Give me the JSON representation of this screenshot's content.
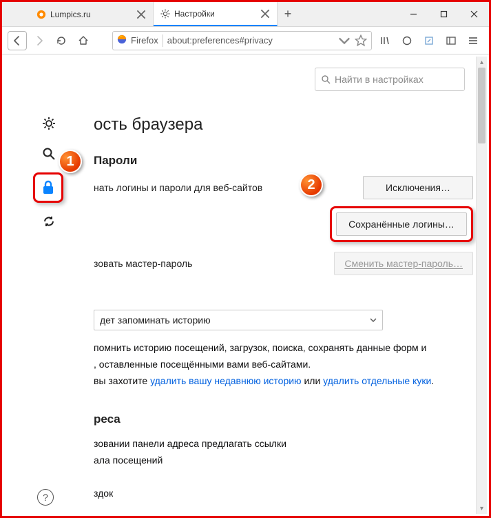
{
  "tabs": [
    {
      "label": "Lumpics.ru",
      "active": false
    },
    {
      "label": "Настройки",
      "active": true
    }
  ],
  "urlbar": {
    "identity": "Firefox",
    "url": "about:preferences#privacy"
  },
  "search": {
    "placeholder": "Найти в настройках"
  },
  "heading": "ость браузера",
  "passwords": {
    "title": "Пароли",
    "remember_label": "нать логины и пароли для веб-сайтов",
    "exceptions_btn": "Исключения…",
    "saved_logins_btn": "Сохранённые логины…",
    "master_label": "зовать мастер-пароль",
    "change_master_btn": "Сменить мастер-пароль…"
  },
  "history": {
    "select_value": "дет запоминать историю",
    "para1": "помнить историю посещений, загрузок, поиска, сохранять данные форм и",
    "para1b": ", оставленные посещёнными вами веб-сайтами.",
    "para2_pre": "вы захотите ",
    "link1": "удалить вашу недавнюю историю",
    "para2_mid": " или ",
    "link2": "удалить отдельные куки",
    "para2_end": "."
  },
  "addresses": {
    "title": "реса",
    "line1": "зовании панели адреса предлагать ссылки",
    "line2": "ала посещений",
    "line3": "здок"
  },
  "markers": {
    "m1": "1",
    "m2": "2"
  }
}
